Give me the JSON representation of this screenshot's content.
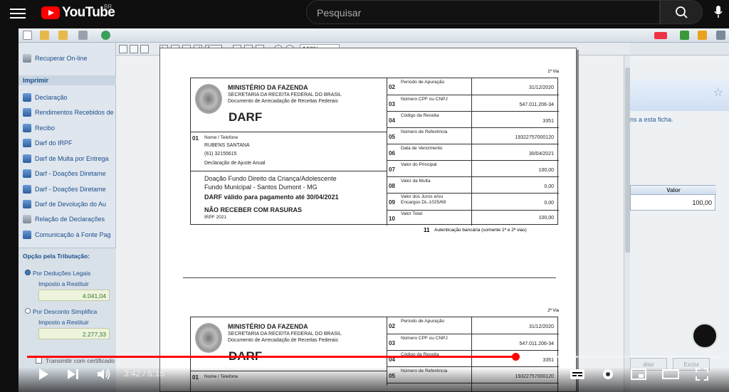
{
  "youtube": {
    "logo_text": "YouTube",
    "country": "BR",
    "search_placeholder": "Pesquisar"
  },
  "program": {
    "left_items": [
      "Recuperar On-line",
      "Declaração",
      "Rendimentos Recebidos de",
      "Recibo",
      "Darf do IRPF",
      "Darf de Multa por Entrega",
      "Darf - Doações Diretame",
      "Darf - Doações Diretame",
      "Darf de Devolução do Au",
      "Relação de Declarações",
      "Comunicação à Fonte Pag"
    ],
    "section_imprimir": "Imprimir",
    "opcao_title": "Opção pela Tributação:",
    "deducoes_label": "Por Deduções Legais",
    "imposto_label_1": "Imposto a Restituir",
    "imposto_value_1": "4.041,04",
    "desconto_label": "Por Desconto Simplifica",
    "imposto_label_2": "Imposto a Restituir",
    "imposto_value_2": "2.277,33",
    "transmitir_label": "Transmitir com certificado"
  },
  "viewer": {
    "page_number": "1",
    "zoom": "100%"
  },
  "darf": {
    "ministerio": "MINISTÉRIO DA FAZENDA",
    "secretaria": "SECRETARIA DA RECEITA FEDERAL DO BRASIL",
    "documento": "Documento de Arrecadação de Receitas Federais",
    "title": "DARF",
    "field01_num": "01",
    "field01_label": "Nome / Telefone",
    "nome": "RUBENS SANTANA",
    "telefone": "(61) 32155615",
    "declaracao": "Declaração de Ajuste Anual",
    "doacao_1": "Doação Fundo Direito da Criança/Adolescente",
    "doacao_2": "Fundo Municipal - Santos Dumont - MG",
    "valido": "DARF válido para pagamento até 30/04/2021",
    "rasuras": "NÃO RECEBER COM RASURAS",
    "irpf": "IRPF 2021",
    "page_mark": "1ª Via",
    "page_mark_2": "2ª Via",
    "rows": [
      {
        "n": "02",
        "label": "Período de Apuração",
        "value": "31/12/2020"
      },
      {
        "n": "03",
        "label": "Número CPF ou CNPJ",
        "value": "547.011.206-34"
      },
      {
        "n": "04",
        "label": "Código da Receita",
        "value": "3351"
      },
      {
        "n": "05",
        "label": "Número de Referência",
        "value": "19322757000120"
      },
      {
        "n": "06",
        "label": "Data de Vencimento",
        "value": "30/04/2021"
      },
      {
        "n": "07",
        "label": "Valor do Principal",
        "value": "100,00"
      },
      {
        "n": "08",
        "label": "Valor da Multa",
        "value": "0,00"
      },
      {
        "n": "09",
        "label": "Valor dos Juros e/ou Encargos DL-1025/69",
        "value": "0,00"
      },
      {
        "n": "10",
        "label": "Valor Total",
        "value": "100,00"
      }
    ],
    "auth_num": "11",
    "auth_text": "Autenticação bancária (somente 1ª e 2ª vias)"
  },
  "right_panel": {
    "ficha_text": "ns a esta ficha.",
    "col_valor": "Valor",
    "valor": "100,00",
    "btn_editar": "ditar",
    "btn_excluir": "Exclui"
  },
  "video": {
    "current_time": "3:42",
    "duration": "5:15",
    "progress_fraction": 0.704
  }
}
